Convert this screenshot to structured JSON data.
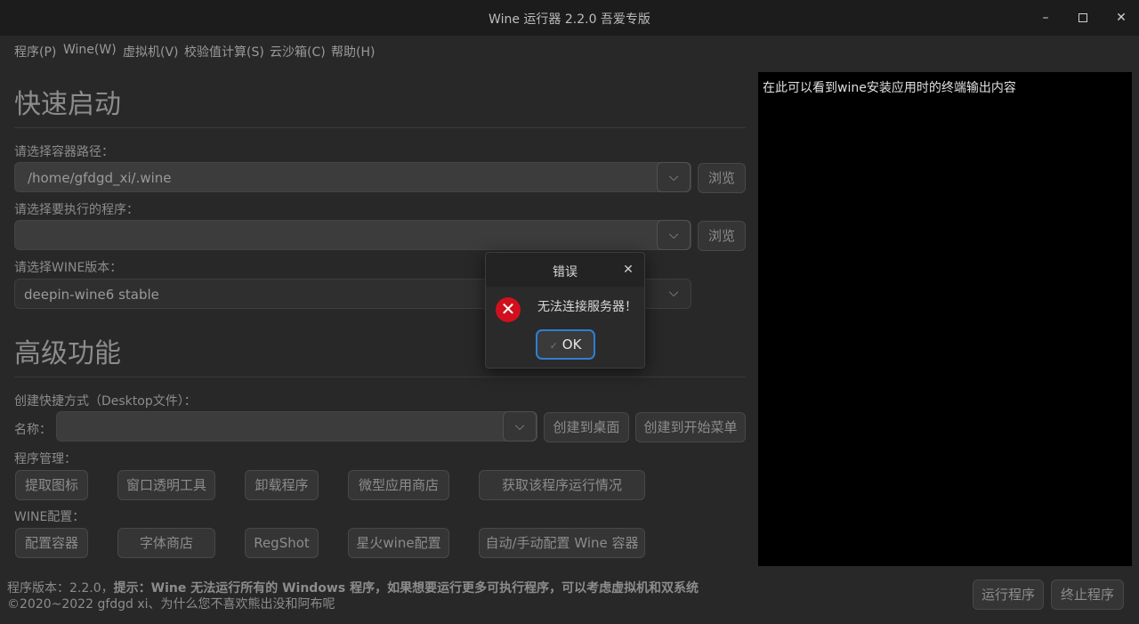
{
  "window": {
    "title": "Wine 运行器 2.2.0 吾爱专版",
    "controls": {
      "minimize": "✕",
      "maximize": "",
      "close": "✕"
    }
  },
  "menu": [
    "程序(P)",
    "Wine(W)",
    "虚拟机(V)",
    "校验值计算(S)",
    "云沙箱(C)",
    "帮助(H)"
  ],
  "quick_start": {
    "title": "快速启动",
    "container_label": "请选择容器路径：",
    "container_value": "/home/gfdgd_xi/.wine",
    "program_label": "请选择要执行的程序：",
    "program_value": "",
    "browse": "浏览",
    "wine_label": "请选择WINE版本：",
    "wine_value": "deepin-wine6 stable"
  },
  "advanced": {
    "title": "高级功能",
    "shortcut_label": "创建快捷方式（Desktop文件）：",
    "name_label": "名称：",
    "name_value": "",
    "to_desktop": "创建到桌面",
    "to_start_menu": "创建到开始菜单",
    "program_mgmt_label": "程序管理：",
    "program_buttons": [
      "提取图标",
      "窗口透明工具",
      "卸载程序",
      "微型应用商店",
      "获取该程序运行情况"
    ],
    "wine_config_label": "WINE配置：",
    "wine_buttons": [
      "配置容器",
      "字体商店",
      "RegShot",
      "星火wine配置",
      "自动/手动配置 Wine 容器"
    ]
  },
  "terminal": {
    "text": "在此可以看到wine安装应用时的终端输出内容"
  },
  "footer": {
    "version_prefix": "程序版本：2.2.0，",
    "tip": "提示：Wine 无法运行所有的 Windows 程序，如果想要运行更多可执行程序，可以考虑虚拟机和双系统",
    "copyright": "©2020~2022 gfdgd xi、为什么您不喜欢熊出没和阿布呢",
    "run": "运行程序",
    "stop": "终止程序"
  },
  "dialog": {
    "title": "错误",
    "message": "无法连接服务器！",
    "ok": "OK",
    "error_color": "#d0101e",
    "focus_color": "#2d7fd6"
  }
}
